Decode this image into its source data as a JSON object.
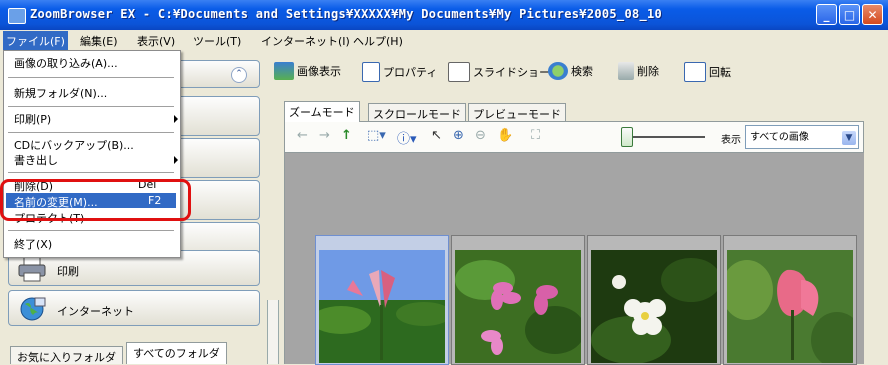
{
  "window": {
    "title": "ZoomBrowser EX  - C:¥Documents and Settings¥XXXXX¥My Documents¥My Pictures¥2005_08_10",
    "minimize": "_",
    "maximize": "□",
    "close": "✕"
  },
  "menubar": {
    "items": [
      "ファイル(F)",
      "編集(E)",
      "表示(V)",
      "ツール(T)",
      "インターネット(I)",
      "ヘルプ(H)"
    ]
  },
  "file_menu": {
    "import": "画像の取り込み(A)...",
    "new_folder": "新規フォルダ(N)...",
    "print": "印刷(P)",
    "cd_backup": "CDにバックアップ(B)...",
    "export": "書き出し",
    "delete": "削除(D)",
    "delete_shortcut": "Del",
    "rename": "名前の変更(M)...",
    "rename_shortcut": "F2",
    "protect": "プロテクト(T)",
    "exit": "終了(X)"
  },
  "left_panel": {
    "print_button": "印刷",
    "internet_button": "インターネット",
    "tabs": [
      "お気に入りフォルダ",
      "すべてのフォルダ"
    ],
    "selected_tab": "すべてのフォルダ"
  },
  "toolbar": {
    "view": "画像表示",
    "properties": "プロパティ",
    "slideshow": "スライドショー",
    "search": "検索",
    "delete": "削除",
    "rotate": "回転"
  },
  "viewer": {
    "tabs": [
      "ズームモード",
      "スクロールモード",
      "プレビューモード"
    ],
    "selected_tab": "ズームモード",
    "display_label": "表示",
    "filter_value": "すべての画像"
  },
  "colors": {
    "selection": "#316ac5",
    "title_bar": "#0a5ce8",
    "highlight_box": "#e01010",
    "thumb_background": "#a5a5a5"
  }
}
